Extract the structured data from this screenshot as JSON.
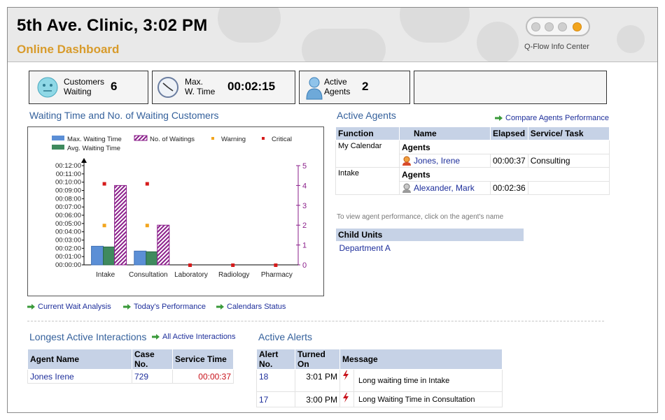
{
  "header": {
    "title": "5th Ave. Clinic, 3:02 PM",
    "subtitle": "Online Dashboard",
    "brand": "Q-Flow Info Center"
  },
  "stats": {
    "customers_waiting": {
      "label1": "Customers",
      "label2": "Waiting",
      "value": "6"
    },
    "max_wait": {
      "label1": "Max.",
      "label2": "W. Time",
      "value": "00:02:15"
    },
    "active_agents": {
      "label1": "Active",
      "label2": "Agents",
      "value": "2"
    }
  },
  "chart_section": {
    "title": "Waiting Time and No. of Waiting Customers"
  },
  "chart_data": {
    "type": "bar",
    "categories": [
      "Intake",
      "Consultation",
      "Laboratory",
      "Radiology",
      "Pharmacy"
    ],
    "left_axis": {
      "ticks": [
        "00:00:00",
        "00:01:00",
        "00:02:00",
        "00:03:00",
        "00:04:00",
        "00:05:00",
        "00:06:00",
        "00:07:00",
        "00:08:00",
        "00:09:00",
        "00:10:00",
        "00:11:00",
        "00:12:00"
      ],
      "ylim_seconds": [
        0,
        720
      ]
    },
    "right_axis": {
      "ticks": [
        "0",
        "1",
        "2",
        "3",
        "4",
        "5"
      ],
      "ylim": [
        0,
        5
      ]
    },
    "series": [
      {
        "name": "Max. Waiting Time",
        "axis": "left",
        "values_seconds": [
          135,
          100,
          0,
          0,
          0
        ],
        "color": "#5b8fd6"
      },
      {
        "name": "Avg. Waiting Time",
        "axis": "left",
        "values_seconds": [
          130,
          95,
          0,
          0,
          0
        ],
        "color": "#3f8a5e"
      },
      {
        "name": "No. of Waitings",
        "axis": "right",
        "values": [
          4,
          2,
          0,
          0,
          0
        ],
        "color": "#8b1f8b"
      },
      {
        "name": "Warning",
        "axis": "right",
        "values": [
          2,
          2,
          null,
          null,
          null
        ],
        "color": "#f2a51e"
      },
      {
        "name": "Critical",
        "axis": "right",
        "values": [
          4.1,
          4.1,
          0,
          0,
          0
        ],
        "color": "#d61b1b"
      }
    ],
    "legend": [
      "Max. Waiting Time",
      "No. of Waitings",
      "Warning",
      "Critical",
      "Avg. Waiting Time"
    ]
  },
  "chart_links": {
    "current_wait": "Current Wait Analysis",
    "todays_perf": "Today's Performance",
    "calendars": "Calendars Status"
  },
  "active_agents": {
    "title": "Active Agents",
    "compare_link": "Compare Agents Performance",
    "columns": [
      "Function",
      "Name",
      "Elapsed",
      "Service/ Task"
    ],
    "groups": [
      {
        "function": "My Calendar",
        "heading": "Agents",
        "name": "Jones, Irene",
        "elapsed": "00:00:37",
        "task": "Consulting"
      },
      {
        "function": "Intake",
        "heading": "Agents",
        "name": "Alexander, Mark",
        "elapsed": "00:02:36",
        "task": ""
      }
    ],
    "note": "To view agent performance, click on the agent's name"
  },
  "child_units": {
    "header": "Child Units",
    "items": [
      "Department A"
    ]
  },
  "longest": {
    "title": "Longest Active Interactions",
    "link": "All Active Interactions",
    "columns": [
      "Agent Name",
      "Case No.",
      "Service Time"
    ],
    "rows": [
      {
        "agent": "Jones Irene",
        "case": "729",
        "time": "00:00:37"
      }
    ]
  },
  "alerts": {
    "title": "Active Alerts",
    "columns": [
      "Alert No.",
      "Turned On",
      "Message"
    ],
    "rows": [
      {
        "no": "18",
        "time": "3:01 PM",
        "message": "Long waiting time in Intake"
      },
      {
        "no": "17",
        "time": "3:00 PM",
        "message": "Long Waiting Time in Consultation"
      }
    ]
  }
}
